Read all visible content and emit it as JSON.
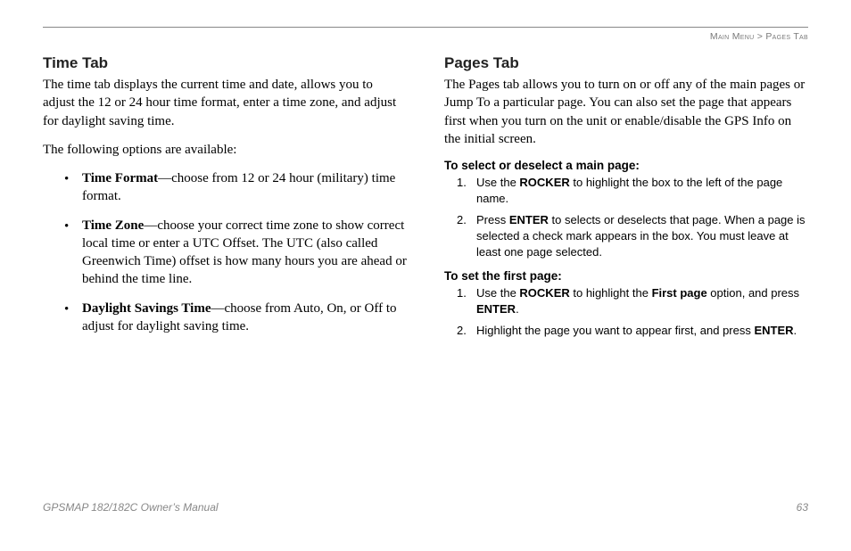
{
  "breadcrumb": {
    "parent": "Main Menu",
    "sep": " > ",
    "current": "Pages Tab"
  },
  "left": {
    "heading": "Time Tab",
    "intro": "The time tab displays the current time and date, allows you to adjust the 12 or 24 hour time format, enter a time zone, and adjust for daylight saving time.",
    "avail": "The following options are available:",
    "bullets": [
      {
        "term": "Time Format",
        "desc": "—choose from 12 or 24 hour (military) time format."
      },
      {
        "term": "Time Zone",
        "desc": "—choose your correct time zone to show correct local time or enter a UTC Offset. The UTC (also called Greenwich Time) offset is how many hours you are ahead or behind the time line."
      },
      {
        "term": "Daylight Savings Time",
        "desc": "—choose from Auto, On, or Off to adjust for daylight saving time."
      }
    ]
  },
  "right": {
    "heading": "Pages Tab",
    "intro": "The Pages tab allows you to turn on or off any of the main pages or Jump To a particular page. You can also set the page that appears first when you turn on the unit or enable/disable the GPS Info on the initial screen.",
    "sec1": {
      "title": "To select or deselect a main page:",
      "steps": [
        {
          "pre": "Use the ",
          "kb1": "ROCKER",
          "post": " to highlight the box to the left of the page name."
        },
        {
          "pre": "Press ",
          "kb1": "ENTER",
          "post": " to selects or deselects that page. When a page is selected a check mark appears in the box. You must leave at least one page selected."
        }
      ]
    },
    "sec2": {
      "title": "To set the first page:",
      "steps": [
        {
          "pre": "Use the ",
          "kb1": "ROCKER",
          "mid": " to highlight the ",
          "kb2": "First page",
          "mid2": " option, and press ",
          "kb3": "ENTER",
          "post": "."
        },
        {
          "pre": "Highlight the page you want to appear first, and press ",
          "kb1": "ENTER",
          "post": "."
        }
      ]
    }
  },
  "footer": {
    "manual": "GPSMAP 182/182C Owner’s Manual",
    "page": "63"
  }
}
